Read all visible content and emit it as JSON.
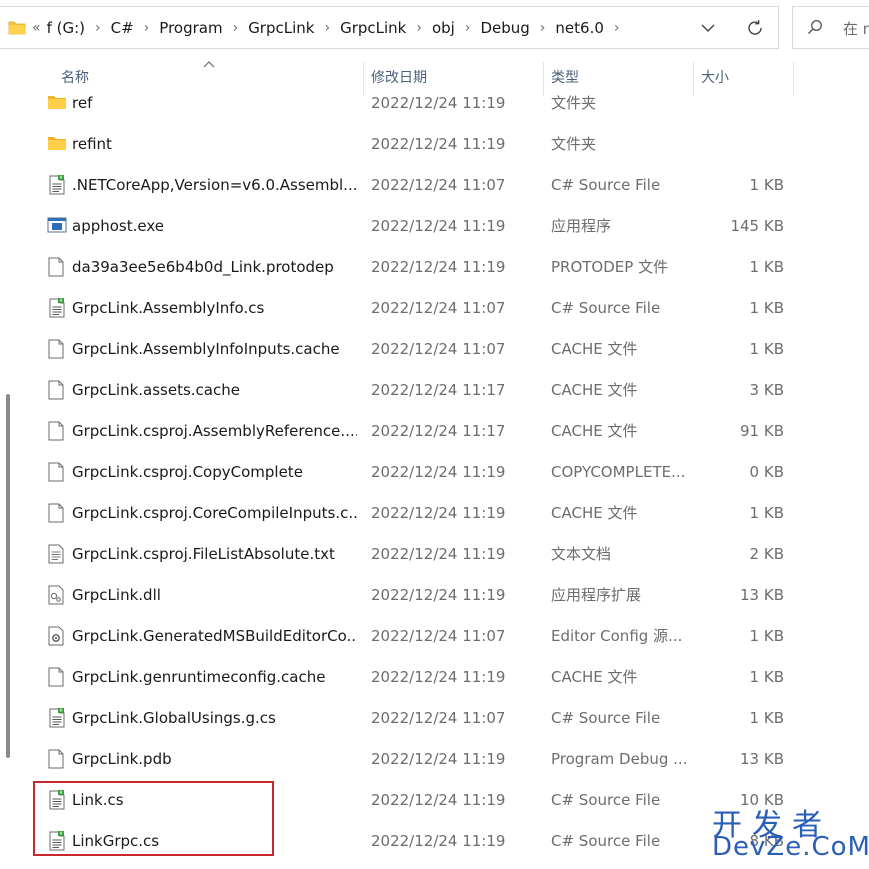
{
  "address_bar": {
    "overflow": "«",
    "crumbs": [
      "f (G:)",
      "C#",
      "Program",
      "GrpcLink",
      "GrpcLink",
      "obj",
      "Debug",
      "net6.0"
    ],
    "separator": "›"
  },
  "search": {
    "text": "在 n"
  },
  "columns": {
    "name": "名称",
    "date": "修改日期",
    "type": "类型",
    "size": "大小"
  },
  "files": [
    {
      "name": "ref",
      "date": "2022/12/24 11:19",
      "type": "文件夹",
      "size": "",
      "icon": "folder-icon"
    },
    {
      "name": "refint",
      "date": "2022/12/24 11:19",
      "type": "文件夹",
      "size": "",
      "icon": "folder-icon"
    },
    {
      "name": ".NETCoreApp,Version=v6.0.Assembl...",
      "date": "2022/12/24 11:07",
      "type": "C# Source File",
      "size": "1 KB",
      "icon": "csharp-file-icon"
    },
    {
      "name": "apphost.exe",
      "date": "2022/12/24 11:19",
      "type": "应用程序",
      "size": "145 KB",
      "icon": "exe-icon"
    },
    {
      "name": "da39a3ee5e6b4b0d_Link.protodep",
      "date": "2022/12/24 11:19",
      "type": "PROTODEP 文件",
      "size": "1 KB",
      "icon": "file-icon"
    },
    {
      "name": "GrpcLink.AssemblyInfo.cs",
      "date": "2022/12/24 11:07",
      "type": "C# Source File",
      "size": "1 KB",
      "icon": "csharp-file-icon"
    },
    {
      "name": "GrpcLink.AssemblyInfoInputs.cache",
      "date": "2022/12/24 11:07",
      "type": "CACHE 文件",
      "size": "1 KB",
      "icon": "file-icon"
    },
    {
      "name": "GrpcLink.assets.cache",
      "date": "2022/12/24 11:17",
      "type": "CACHE 文件",
      "size": "3 KB",
      "icon": "file-icon"
    },
    {
      "name": "GrpcLink.csproj.AssemblyReference....",
      "date": "2022/12/24 11:17",
      "type": "CACHE 文件",
      "size": "91 KB",
      "icon": "file-icon"
    },
    {
      "name": "GrpcLink.csproj.CopyComplete",
      "date": "2022/12/24 11:19",
      "type": "COPYCOMPLETE...",
      "size": "0 KB",
      "icon": "file-icon"
    },
    {
      "name": "GrpcLink.csproj.CoreCompileInputs.c...",
      "date": "2022/12/24 11:19",
      "type": "CACHE 文件",
      "size": "1 KB",
      "icon": "file-icon"
    },
    {
      "name": "GrpcLink.csproj.FileListAbsolute.txt",
      "date": "2022/12/24 11:19",
      "type": "文本文档",
      "size": "2 KB",
      "icon": "text-file-icon"
    },
    {
      "name": "GrpcLink.dll",
      "date": "2022/12/24 11:19",
      "type": "应用程序扩展",
      "size": "13 KB",
      "icon": "dll-icon"
    },
    {
      "name": "GrpcLink.GeneratedMSBuildEditorCo...",
      "date": "2022/12/24 11:07",
      "type": "Editor Config 源...",
      "size": "1 KB",
      "icon": "config-file-icon"
    },
    {
      "name": "GrpcLink.genruntimeconfig.cache",
      "date": "2022/12/24 11:19",
      "type": "CACHE 文件",
      "size": "1 KB",
      "icon": "file-icon"
    },
    {
      "name": "GrpcLink.GlobalUsings.g.cs",
      "date": "2022/12/24 11:07",
      "type": "C# Source File",
      "size": "1 KB",
      "icon": "csharp-file-icon"
    },
    {
      "name": "GrpcLink.pdb",
      "date": "2022/12/24 11:19",
      "type": "Program Debug ...",
      "size": "13 KB",
      "icon": "file-icon"
    },
    {
      "name": "Link.cs",
      "date": "2022/12/24 11:19",
      "type": "C# Source File",
      "size": "10 KB",
      "icon": "csharp-file-icon"
    },
    {
      "name": "LinkGrpc.cs",
      "date": "2022/12/24 11:19",
      "type": "C# Source File",
      "size": "8 KB",
      "icon": "csharp-file-icon"
    }
  ],
  "watermark": {
    "top": "开发者",
    "bottom": "DevZe.CoM"
  },
  "colors": {
    "highlight": "#c8272e",
    "watermark": "#2a5fb8",
    "folder": "#f4c542"
  }
}
